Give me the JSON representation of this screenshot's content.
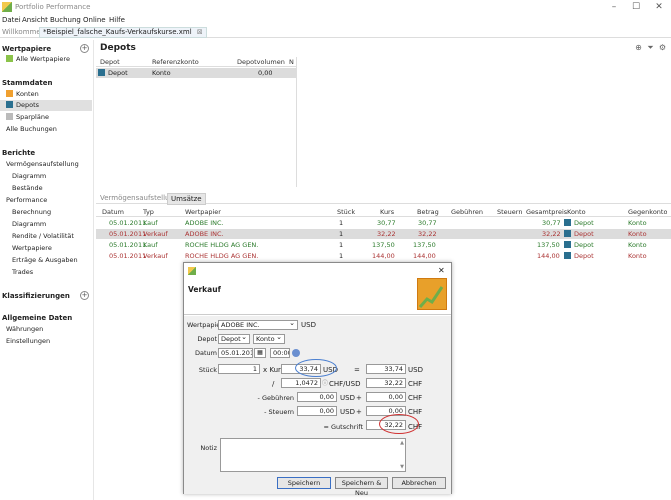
{
  "app": {
    "title": "Portfolio Performance"
  },
  "window": {
    "minimize": "–",
    "maximize": "☐",
    "close": "✕"
  },
  "menu": [
    "Datei",
    "Ansicht",
    "Buchung",
    "Online",
    "Hilfe"
  ],
  "tabs": [
    {
      "label": "Willkommen"
    },
    {
      "label": "*Beispiel_falsche_Kaufs-Verkaufskurse.xml",
      "close": "⊠"
    }
  ],
  "sidebar": {
    "wertpapiere_header": "Wertpapiere",
    "alle_wertpapiere": "Alle Wertpapiere",
    "stammdaten_header": "Stammdaten",
    "konten": "Konten",
    "depots": "Depots",
    "sparplaene": "Sparpläne",
    "alle_buchungen": "Alle Buchungen",
    "berichte_header": "Berichte",
    "vermoegensaufstellung": "Vermögensaufstellung",
    "diagramm1": "Diagramm",
    "bestaende": "Bestände",
    "performance": "Performance",
    "berechnung": "Berechnung",
    "diagramm2": "Diagramm",
    "rendite": "Rendite / Volatilität",
    "wertpapiere_sub": "Wertpapiere",
    "ertraege": "Erträge & Ausgaben",
    "trades": "Trades",
    "klassifizierungen_header": "Klassifizierungen",
    "allgemeine_header": "Allgemeine Daten",
    "waehrungen": "Währungen",
    "einstellungen": "Einstellungen"
  },
  "depots": {
    "title": "Depots",
    "columns": [
      "Depot",
      "Referenzkonto",
      "Depotvolumen",
      "N"
    ],
    "row": {
      "depot": "Depot",
      "konto": "Konto",
      "volumen": "0,00"
    }
  },
  "subtabs": [
    "Vermögensaufstellung",
    "Umsätze"
  ],
  "umsaetze": {
    "columns": [
      "Datum",
      "Typ",
      "Wertpapier",
      "Stück",
      "Kurs",
      "Betrag",
      "Gebühren",
      "Steuern",
      "Gesamtpreis",
      "Konto",
      "Gegenkonto"
    ],
    "rows": [
      {
        "datum": "05.01.2011",
        "typ": "Kauf",
        "wp": "ADOBE INC.",
        "stueck": "1",
        "kurs": "30,77",
        "betrag": "30,77",
        "gesamt": "30,77",
        "konto": "Depot",
        "gegen": "Konto"
      },
      {
        "datum": "05.01.2011",
        "typ": "Verkauf",
        "wp": "ADOBE INC.",
        "stueck": "1",
        "kurs": "32,22",
        "betrag": "32,22",
        "gesamt": "32,22",
        "konto": "Depot",
        "gegen": "Konto"
      },
      {
        "datum": "05.01.2011",
        "typ": "Kauf",
        "wp": "ROCHE HLDG AG GEN.",
        "stueck": "1",
        "kurs": "137,50",
        "betrag": "137,50",
        "gesamt": "137,50",
        "konto": "Depot",
        "gegen": "Konto"
      },
      {
        "datum": "05.01.2011",
        "typ": "Verkauf",
        "wp": "ROCHE HLDG AG GEN.",
        "stueck": "1",
        "kurs": "144,00",
        "betrag": "144,00",
        "gesamt": "144,00",
        "konto": "Depot",
        "gegen": "Konto"
      }
    ]
  },
  "dialog": {
    "title": "Verkauf",
    "close": "✕",
    "wertpapier_label": "Wertpapier",
    "wertpapier_value": "ADOBE INC.",
    "wertpapier_currency": "USD",
    "depot_label": "Depot",
    "depot_value": "Depot",
    "konto_value": "Konto",
    "datum_label": "Datum",
    "datum_value": "05.01.2011",
    "zeit_value": "00:00",
    "stueck_label": "Stück",
    "stueck_value": "1",
    "x_kurs": "x Kurs",
    "kurs_value": "33,74",
    "kurs_currency": "USD",
    "eq": "=",
    "betrag_usd": "33,74",
    "usd": "USD",
    "slash": "/",
    "rate_value": "1,0472",
    "rate_unit": "CHF/USD",
    "betrag_chf": "32,22",
    "chf": "CHF",
    "gebuehren_label": "- Gebühren",
    "gebuehren_value": "0,00",
    "gebuehren_chf": "0,00",
    "steuern_label": "- Steuern",
    "steuern_value": "0,00",
    "steuern_chf": "0,00",
    "plus": "+",
    "gutschrift_label": "= Gutschrift",
    "gutschrift_value": "32,22",
    "notiz_label": "Notiz",
    "btn_save": "Speichern",
    "btn_save_new": "Speichern & Neu",
    "btn_cancel": "Abbrechen"
  }
}
